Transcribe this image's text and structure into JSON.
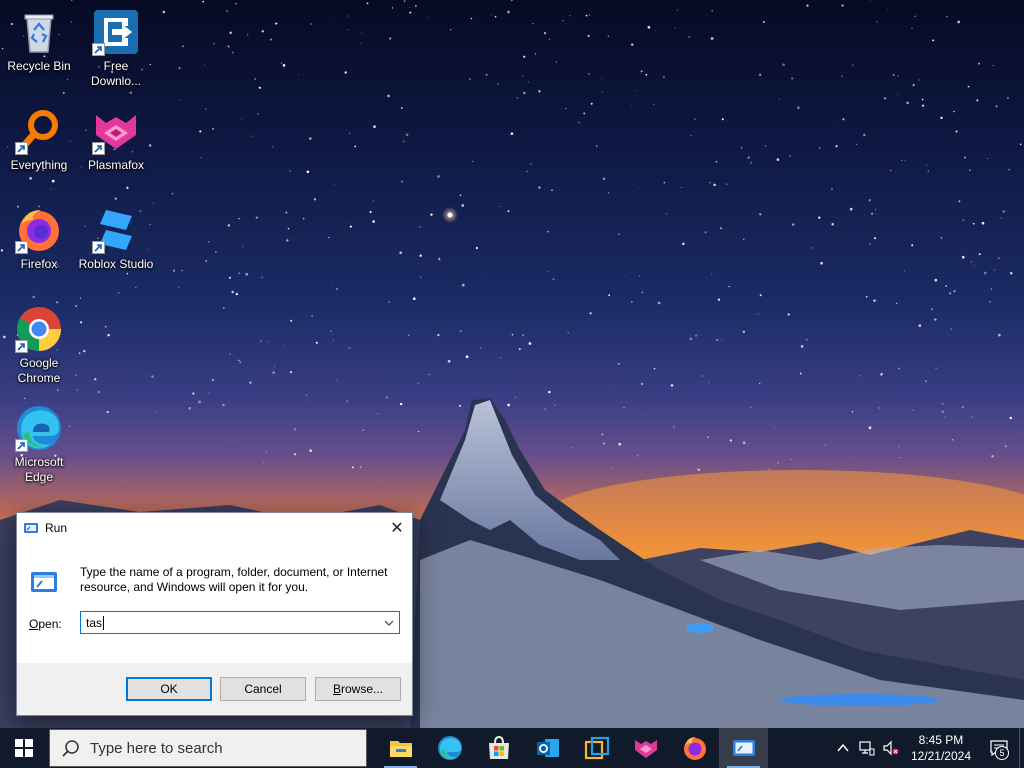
{
  "desktop": {
    "icons": [
      {
        "label": "Recycle Bin",
        "icon": "recycle-bin-icon"
      },
      {
        "label": "Free Downlo...",
        "icon": "free-download-manager-icon"
      },
      {
        "label": "Everything",
        "icon": "everything-search-icon"
      },
      {
        "label": "Plasmafox",
        "icon": "plasmafox-icon"
      },
      {
        "label": "Firefox",
        "icon": "firefox-icon"
      },
      {
        "label": "Roblox Studio",
        "icon": "roblox-studio-icon"
      },
      {
        "label": "Google Chrome",
        "icon": "chrome-icon"
      },
      {
        "label": "Microsoft Edge",
        "icon": "edge-icon"
      }
    ]
  },
  "run_dialog": {
    "title": "Run",
    "description": "Type the name of a program, folder, document, or Internet resource, and Windows will open it for you.",
    "open_label_key": "O",
    "open_label_rest": "pen:",
    "input_value": "tas",
    "ok_label": "OK",
    "cancel_label": "Cancel",
    "browse_key": "B",
    "browse_rest": "rowse...",
    "close_glyph": "✕"
  },
  "taskbar": {
    "search_placeholder": "Type here to search",
    "apps": [
      {
        "name": "File Explorer",
        "icon": "file-explorer-icon"
      },
      {
        "name": "Microsoft Edge",
        "icon": "edge-icon"
      },
      {
        "name": "Microsoft Store",
        "icon": "store-icon"
      },
      {
        "name": "Outlook",
        "icon": "outlook-icon"
      },
      {
        "name": "Photos",
        "icon": "photos-icon"
      },
      {
        "name": "Plasmafox",
        "icon": "plasmafox-icon"
      },
      {
        "name": "Firefox",
        "icon": "firefox-icon"
      },
      {
        "name": "Run",
        "icon": "run-icon"
      }
    ],
    "clock_time": "8:45 PM",
    "clock_date": "12/21/2024",
    "notification_count": "5",
    "accent": "#0078d7"
  }
}
